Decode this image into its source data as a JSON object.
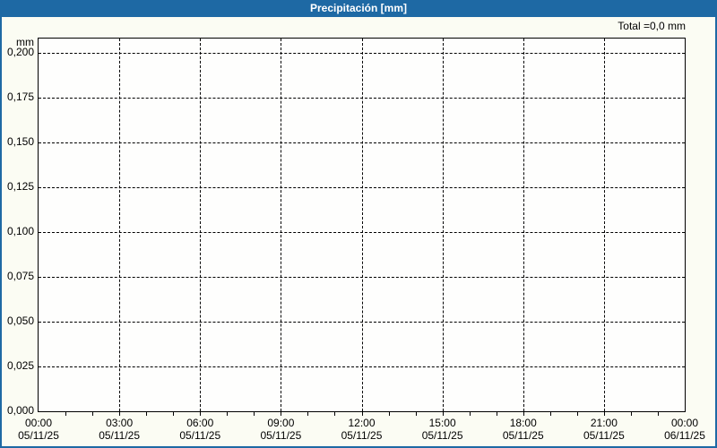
{
  "title_bar": {
    "title": "Precipitación [mm]"
  },
  "header": {
    "total_label": "Total =0,0 mm"
  },
  "colors": {
    "accent_blue": "#1e69a4",
    "page_background": "#fbfcf3",
    "plot_background": "#fefefd",
    "grid_and_text": "#000000",
    "title_text": "#ffffff"
  },
  "chart_data": {
    "type": "bar",
    "title": "Precipitación [mm]",
    "ylabel_unit": "mm",
    "total_text": "Total =0,0 mm",
    "total_value_mm": 0.0,
    "grid": "dashed",
    "legend_position": "none",
    "series": [
      {
        "name": "Precipitación",
        "values": [],
        "total_mm": 0.0,
        "note": "no precipitation plotted; total shown as 0,0 mm"
      }
    ],
    "x_axis": {
      "start": "05/11/25 00:00",
      "end": "06/11/25 00:00",
      "major_tick_hours": 3,
      "minor_tick_hours": 1,
      "span_hours": 24
    },
    "y_axis": {
      "min": 0.0,
      "top_tick": 0.2,
      "tick_step": 0.025
    },
    "y_ticks": [
      {
        "label": "0,200",
        "value": 0.2
      },
      {
        "label": "0,175",
        "value": 0.175
      },
      {
        "label": "0,150",
        "value": 0.15
      },
      {
        "label": "0,125",
        "value": 0.125
      },
      {
        "label": "0,100",
        "value": 0.1
      },
      {
        "label": "0,075",
        "value": 0.075
      },
      {
        "label": "0,050",
        "value": 0.05
      },
      {
        "label": "0,025",
        "value": 0.025
      },
      {
        "label": "0,000",
        "value": 0.0
      }
    ],
    "x_ticks": [
      {
        "time": "00:00",
        "date": "05/11/25",
        "hour": 0
      },
      {
        "time": "03:00",
        "date": "05/11/25",
        "hour": 3
      },
      {
        "time": "06:00",
        "date": "05/11/25",
        "hour": 6
      },
      {
        "time": "09:00",
        "date": "05/11/25",
        "hour": 9
      },
      {
        "time": "12:00",
        "date": "05/11/25",
        "hour": 12
      },
      {
        "time": "15:00",
        "date": "05/11/25",
        "hour": 15
      },
      {
        "time": "18:00",
        "date": "05/11/25",
        "hour": 18
      },
      {
        "time": "21:00",
        "date": "05/11/25",
        "hour": 21
      },
      {
        "time": "00:00",
        "date": "06/11/25",
        "hour": 24
      }
    ]
  }
}
